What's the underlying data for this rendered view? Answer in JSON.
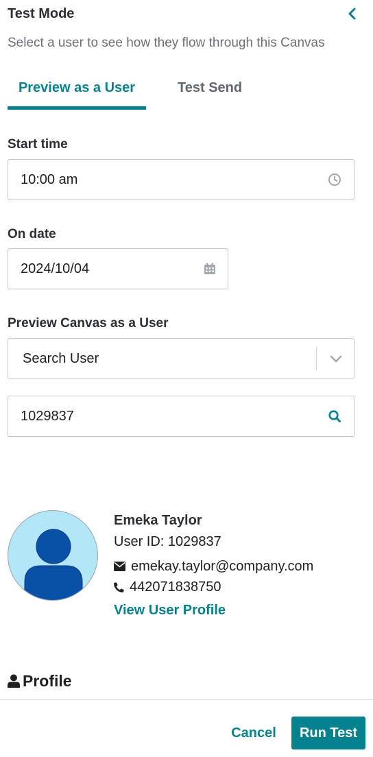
{
  "header": {
    "title": "Test Mode",
    "subtitle": "Select a user to see how they flow through this Canvas"
  },
  "tabs": [
    {
      "label": "Preview as a User",
      "active": true
    },
    {
      "label": "Test Send",
      "active": false
    }
  ],
  "start_time": {
    "label": "Start time",
    "value": "10:00 am",
    "icon": "clock-icon"
  },
  "on_date": {
    "label": "On date",
    "value": "2024/10/04",
    "icon": "calendar-icon"
  },
  "preview_user": {
    "label": "Preview Canvas as a User",
    "select_value": "Search User",
    "search_value": "1029837"
  },
  "user": {
    "name": "Emeka Taylor",
    "user_id": "User ID: 1029837",
    "email": "emekay.taylor@company.com",
    "phone": "442071838750",
    "profile_link": "View User Profile"
  },
  "profile_section": {
    "label": "Profile"
  },
  "footer": {
    "cancel_label": "Cancel",
    "run_label": "Run Test"
  },
  "colors": {
    "accent": "#06818e",
    "avatar_bg": "#b3e7f8",
    "avatar_figure": "#0a50a6"
  }
}
